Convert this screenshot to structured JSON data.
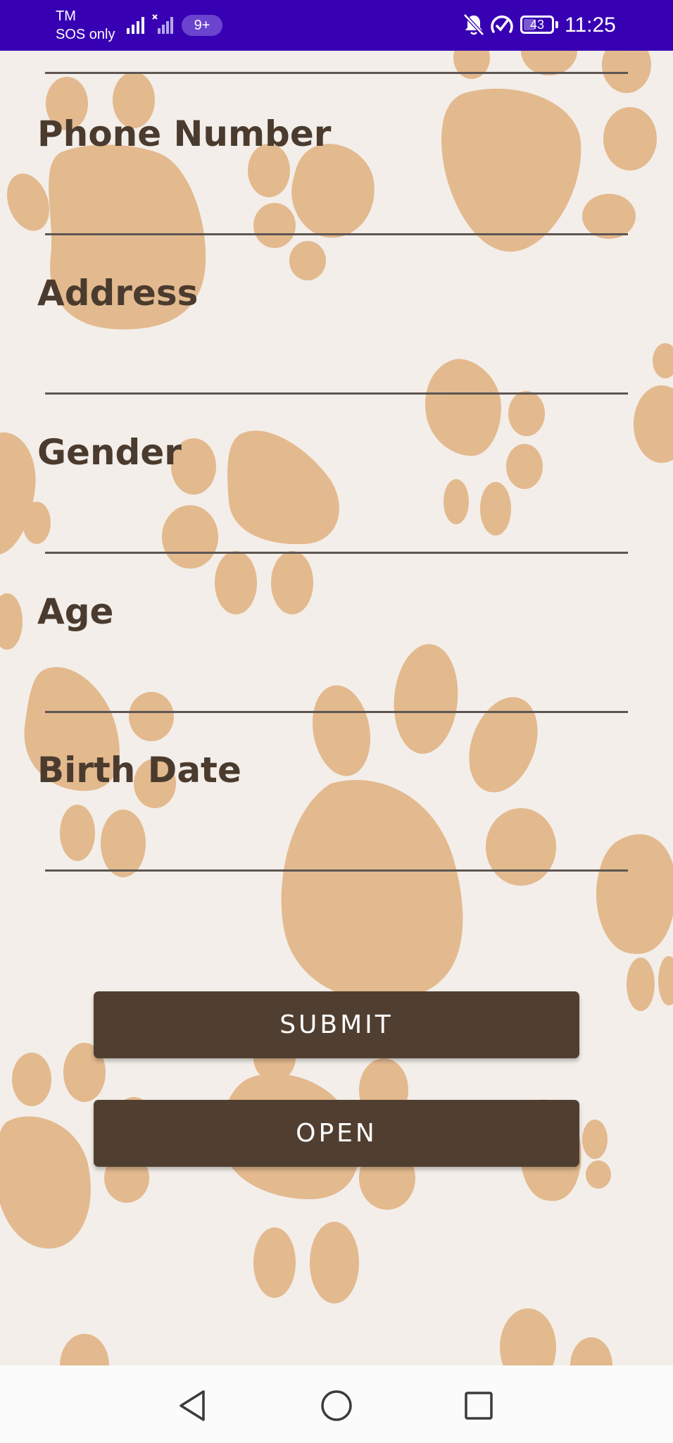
{
  "status_bar": {
    "carrier_line1": "TM",
    "carrier_line2": "SOS only",
    "notification_badge": "9+",
    "battery_percent": "43",
    "battery_level": 0.43,
    "time": "11:25",
    "icons": [
      "signal-icon",
      "no-signal-icon",
      "bell-off-icon",
      "data-saver-icon",
      "battery-icon"
    ]
  },
  "form": {
    "fields": [
      {
        "label": "Phone Number",
        "value": "",
        "placeholder": ""
      },
      {
        "label": "Address",
        "value": "",
        "placeholder": ""
      },
      {
        "label": "Gender",
        "value": "",
        "placeholder": ""
      },
      {
        "label": "Age",
        "value": "",
        "placeholder": ""
      },
      {
        "label": "Birth Date",
        "value": "",
        "placeholder": ""
      }
    ],
    "submit_label": "SUBMIT",
    "open_label": "OPEN"
  },
  "nav_bar": {
    "icons": [
      "back-triangle-icon",
      "home-circle-icon",
      "recents-square-icon"
    ]
  },
  "colors": {
    "status_bar": "#3700b3",
    "background": "#f3eee9",
    "paw": "#e2b587",
    "label_text": "#4a3b2e",
    "button": "#503f31",
    "button_text": "#ffffff",
    "underline": "#5d5652"
  }
}
